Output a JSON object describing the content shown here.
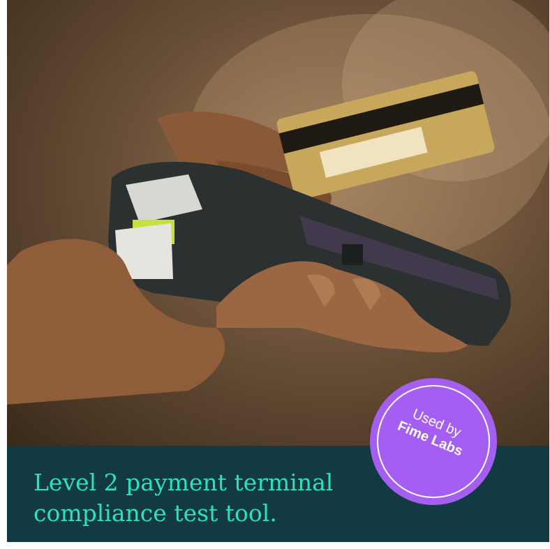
{
  "hero": {
    "image_alt": "Hand holding a payment terminal while a card is tapped",
    "background_color": "#6a5038"
  },
  "footer": {
    "headline": "Level 2 payment terminal compliance test tool.",
    "background_color": "#123a42",
    "text_color": "#2ee0bf"
  },
  "badge": {
    "line1": "Used by",
    "line2": "Fime Labs",
    "color": "#a45ff2"
  }
}
